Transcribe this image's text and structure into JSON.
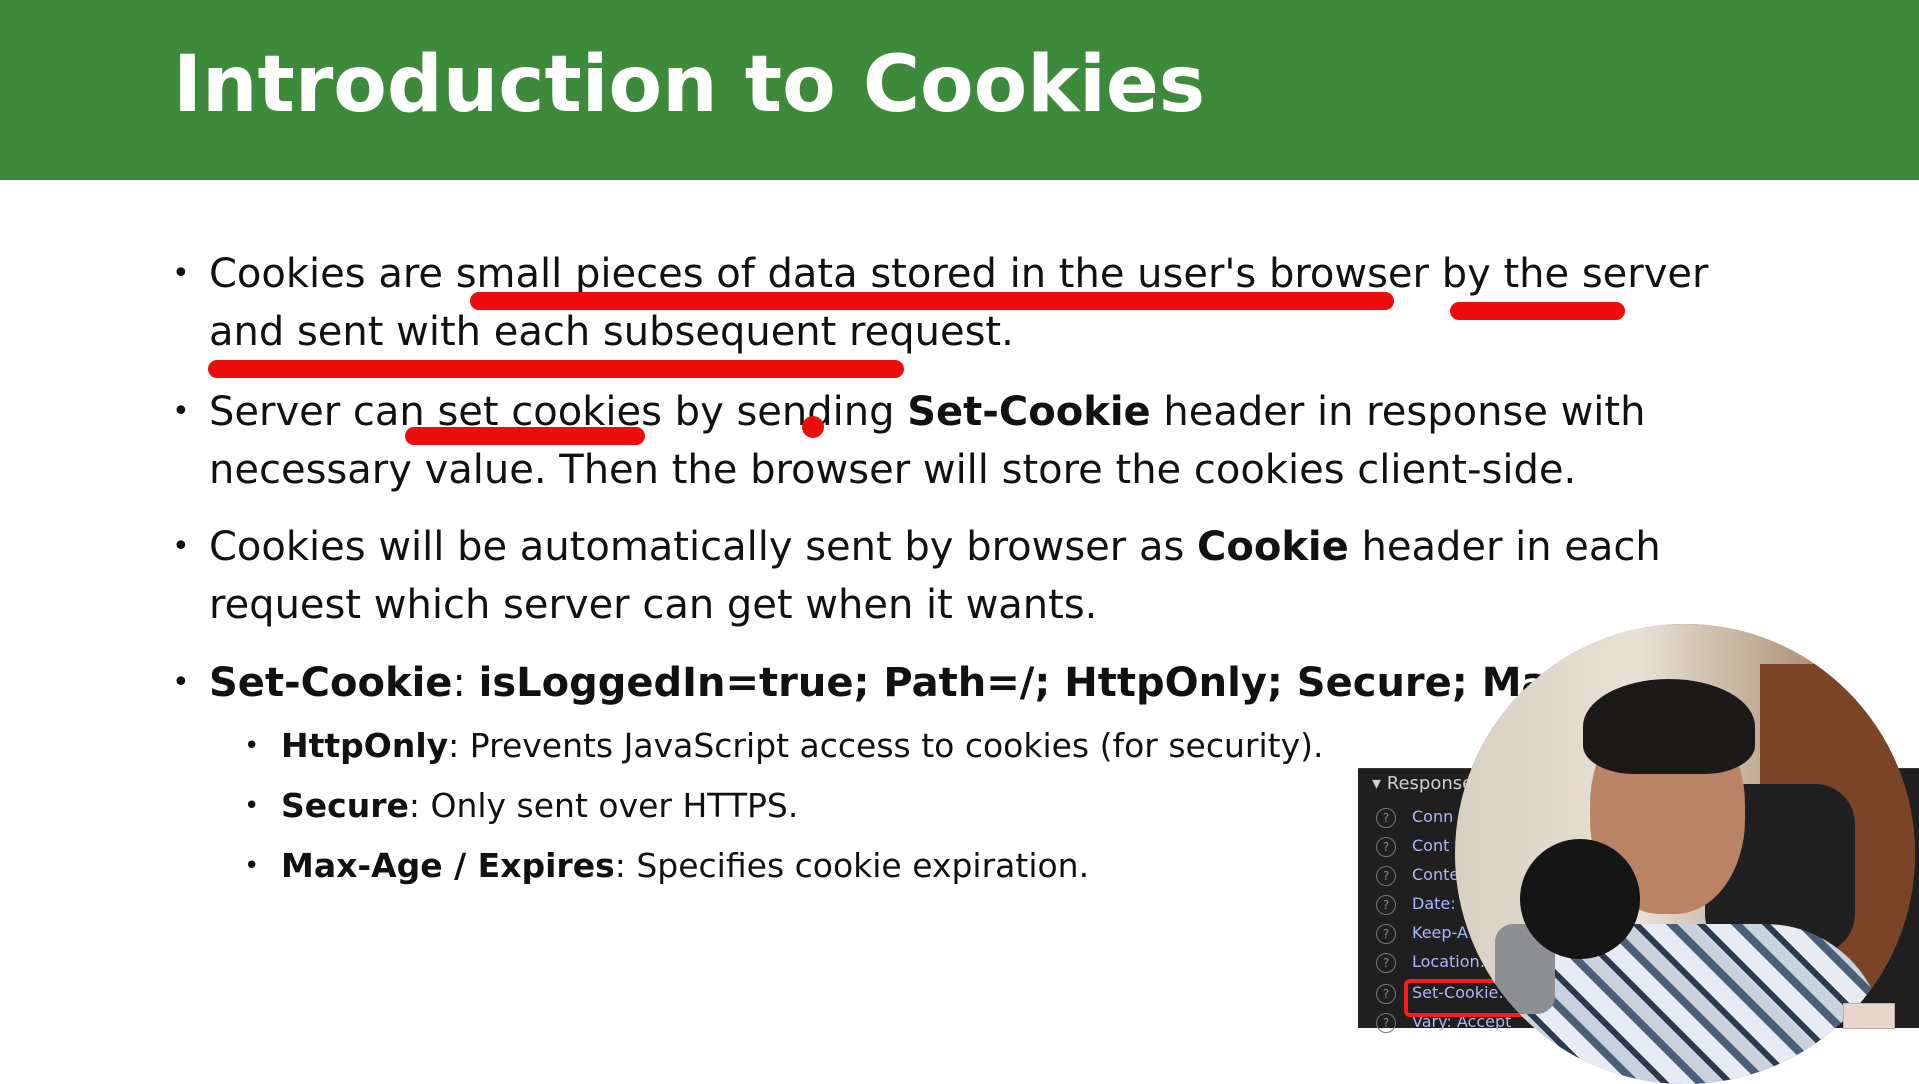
{
  "slide": {
    "title": "Introduction to Cookies",
    "bullets": [
      {
        "parts": [
          {
            "text": "Cookies are small pieces of data stored in the user's browser by the server and sent with each subsequent request.",
            "bold": false
          }
        ]
      },
      {
        "parts": [
          {
            "text": "Server can set cookies by sending ",
            "bold": false
          },
          {
            "text": "Set-Cookie",
            "bold": true
          },
          {
            "text": " header in response with necessary value. Then the browser will store the cookies client-side.",
            "bold": false
          }
        ]
      },
      {
        "parts": [
          {
            "text": "Cookies will be automatically sent by browser as ",
            "bold": false
          },
          {
            "text": "Cookie",
            "bold": true
          },
          {
            "text": " header in each request which server can get when it wants.",
            "bold": false
          }
        ]
      },
      {
        "parts": [
          {
            "text": "Set-Cookie",
            "bold": true
          },
          {
            "text": ": ",
            "bold": false
          },
          {
            "text": "isLoggedIn=true; Path=/; HttpOnly; Secure; Max-Ac",
            "bold": true
          }
        ]
      }
    ],
    "sub_bullets": [
      {
        "term": "HttpOnly",
        "desc": ": Prevents JavaScript access to cookies (for security)."
      },
      {
        "term": "Secure",
        "desc": ": Only sent over HTTPS."
      },
      {
        "term": "Max-Age / Expires",
        "desc": ": Specifies cookie expiration."
      }
    ],
    "bullet_glyph": "•"
  },
  "devtools": {
    "section": "▾ Response",
    "rows": [
      "Conn",
      "Cont",
      "Conte",
      "Date:",
      "Keep-A",
      "Location:",
      "Set-Cookie:",
      "Vary: Accept"
    ],
    "highlighted_row": "Set-Cookie:"
  },
  "colors": {
    "header_bg": "#3e8a3b",
    "annotation_red": "#ee0d0d"
  }
}
